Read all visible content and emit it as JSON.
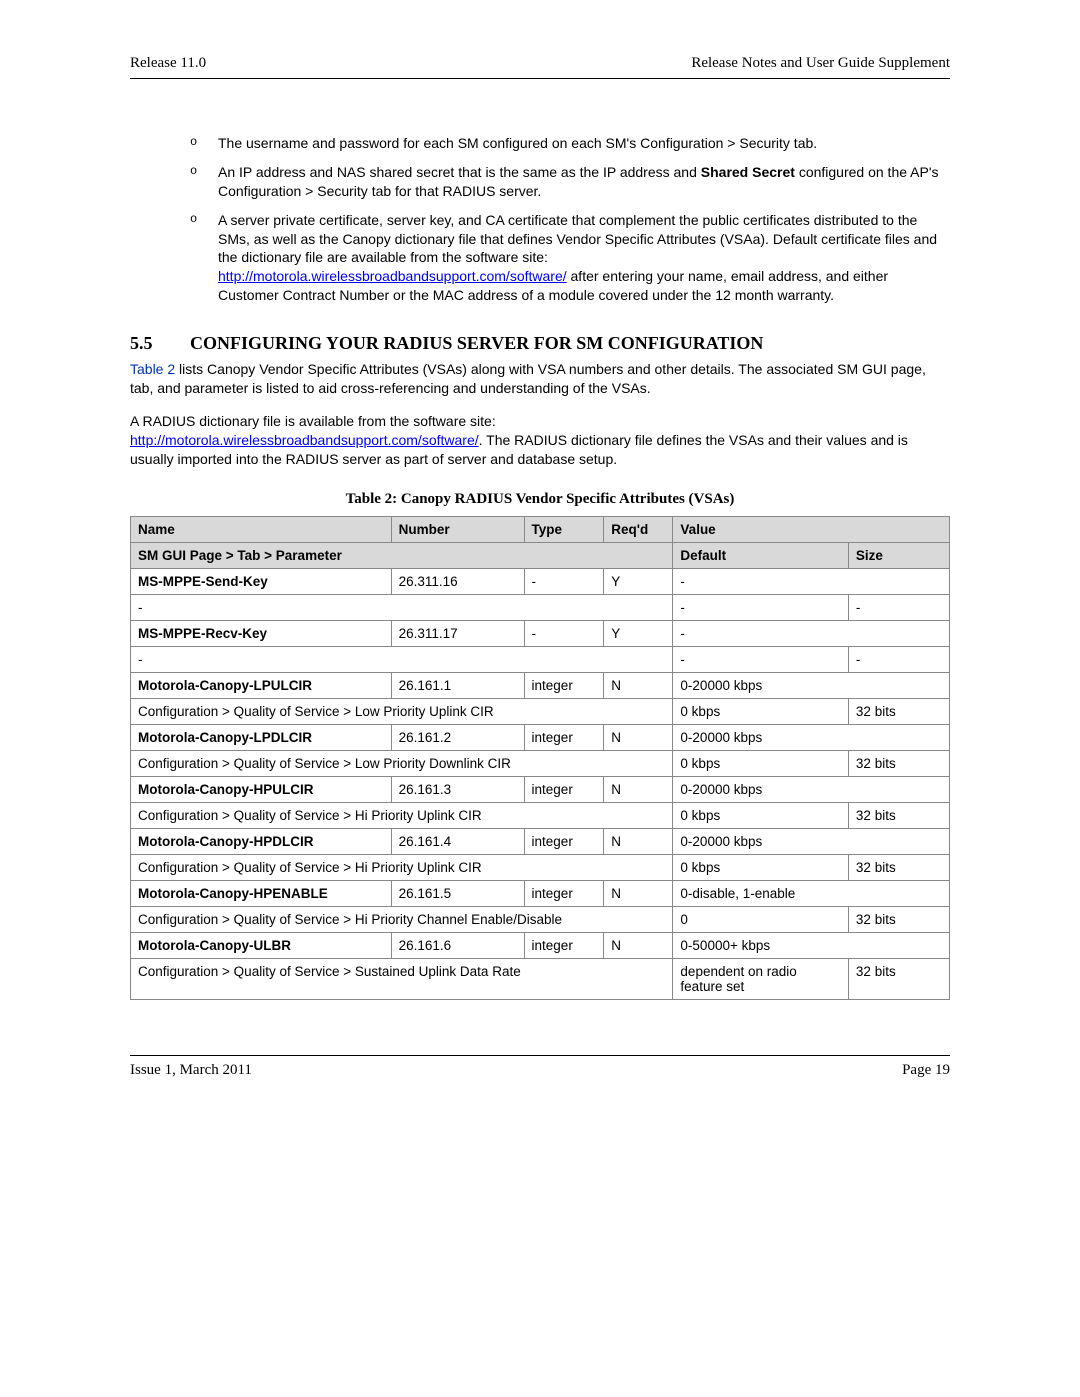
{
  "header": {
    "left": "Release 11.0",
    "right": "Release Notes and User Guide Supplement"
  },
  "footer": {
    "left": "Issue 1, March 2011",
    "right": "Page 19"
  },
  "bullets": [
    {
      "pre": "The username and password for each SM configured on each SM's Configuration > Security tab."
    },
    {
      "pre": "An IP address and NAS shared secret that is the same as the IP address and ",
      "bold": "Shared Secret",
      "post": " configured on the AP's Configuration > Security tab for that RADIUS server."
    },
    {
      "pre": "A server private certificate, server key, and CA certificate that complement the public certificates distributed to the SMs, as well as the Canopy dictionary file that defines Vendor Specific Attributes (VSAa). Default certificate files and the dictionary file are available from the software site: ",
      "link": "http://motorola.wirelessbroadbandsupport.com/software/",
      "post2": " after entering your name, email address, and either Customer Contract Number or the MAC address of a module covered under the 12 month warranty."
    }
  ],
  "section": {
    "num": "5.5",
    "title": "CONFIGURING YOUR RADIUS SERVER FOR SM CONFIGURATION"
  },
  "para1": {
    "ref": "Table 2",
    "text": " lists Canopy Vendor Specific Attributes (VSAs) along with VSA numbers and other details. The associated SM GUI page, tab, and parameter is listed to aid cross-referencing and understanding of the VSAs."
  },
  "para2": {
    "pre": "A RADIUS dictionary file is available from the software site: ",
    "link": "http://motorola.wirelessbroadbandsupport.com/software/",
    "post": ". The RADIUS dictionary file defines the VSAs and their values and is usually imported into the RADIUS server as part of server and database setup."
  },
  "tableCaption": "Table 2: Canopy RADIUS Vendor Specific Attributes (VSAs)",
  "tableHeader1": {
    "name": "Name",
    "number": "Number",
    "type": "Type",
    "reqd": "Req'd",
    "value": "Value"
  },
  "tableHeader2": {
    "path": "SM GUI Page > Tab > Parameter",
    "default": "Default",
    "size": "Size"
  },
  "rows": [
    {
      "name": "MS-MPPE-Send-Key",
      "number": "26.311.16",
      "type": "-",
      "reqd": "Y",
      "value": "-",
      "path": "-",
      "default": "-",
      "size": "-"
    },
    {
      "name": "MS-MPPE-Recv-Key",
      "number": "26.311.17",
      "type": "-",
      "reqd": "Y",
      "value": "-",
      "path": "-",
      "default": "-",
      "size": "-"
    },
    {
      "name": "Motorola-Canopy-LPULCIR",
      "number": "26.161.1",
      "type": "integer",
      "reqd": "N",
      "value": "0-20000 kbps",
      "path": "Configuration > Quality of Service > Low Priority Uplink CIR",
      "default": "0 kbps",
      "size": "32 bits"
    },
    {
      "name": "Motorola-Canopy-LPDLCIR",
      "number": "26.161.2",
      "type": "integer",
      "reqd": "N",
      "value": "0-20000 kbps",
      "path": "Configuration > Quality of Service > Low Priority Downlink CIR",
      "default": "0 kbps",
      "size": "32 bits"
    },
    {
      "name": "Motorola-Canopy-HPULCIR",
      "number": "26.161.3",
      "type": "integer",
      "reqd": "N",
      "value": "0-20000 kbps",
      "path": "Configuration > Quality of Service > Hi Priority Uplink CIR",
      "default": "0 kbps",
      "size": "32 bits"
    },
    {
      "name": "Motorola-Canopy-HPDLCIR",
      "number": "26.161.4",
      "type": "integer",
      "reqd": "N",
      "value": "0-20000 kbps",
      "path": "Configuration > Quality of Service > Hi Priority Uplink CIR",
      "default": "0 kbps",
      "size": "32 bits"
    },
    {
      "name": "Motorola-Canopy-HPENABLE",
      "number": "26.161.5",
      "type": "integer",
      "reqd": "N",
      "value": "0-disable, 1-enable",
      "path": "Configuration > Quality of Service > Hi Priority Channel Enable/Disable",
      "default": "0",
      "size": "32 bits"
    },
    {
      "name": "Motorola-Canopy-ULBR",
      "number": "26.161.6",
      "type": "integer",
      "reqd": "N",
      "value": "0-50000+ kbps",
      "path": "Configuration > Quality of Service > Sustained Uplink Data Rate",
      "default": "dependent on radio feature set",
      "size": "32 bits"
    }
  ]
}
